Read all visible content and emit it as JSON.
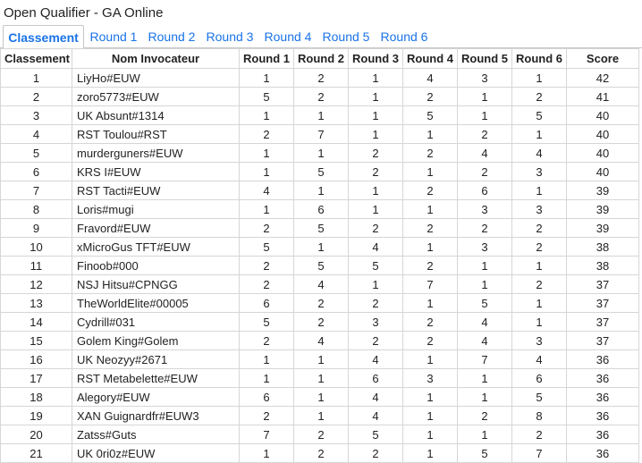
{
  "title": "Open Qualifier - GA Online",
  "tabs": [
    {
      "label": "Classement",
      "active": true
    },
    {
      "label": "Round 1",
      "active": false
    },
    {
      "label": "Round 2",
      "active": false
    },
    {
      "label": "Round 3",
      "active": false
    },
    {
      "label": "Round 4",
      "active": false
    },
    {
      "label": "Round 5",
      "active": false
    },
    {
      "label": "Round 6",
      "active": false
    }
  ],
  "colors": {
    "accent": "#1a73e8",
    "border": "#d6d6d6"
  },
  "table": {
    "headers": [
      "Classement",
      "Nom Invocateur",
      "Round 1",
      "Round 2",
      "Round 3",
      "Round 4",
      "Round 5",
      "Round 6",
      "Score"
    ],
    "rows": [
      [
        "1",
        "LiyHo#EUW",
        "1",
        "2",
        "1",
        "4",
        "3",
        "1",
        "42"
      ],
      [
        "2",
        "zoro5773#EUW",
        "5",
        "2",
        "1",
        "2",
        "1",
        "2",
        "41"
      ],
      [
        "3",
        "UK Absunt#1314",
        "1",
        "1",
        "1",
        "5",
        "1",
        "5",
        "40"
      ],
      [
        "4",
        "RST Toulou#RST",
        "2",
        "7",
        "1",
        "1",
        "2",
        "1",
        "40"
      ],
      [
        "5",
        "murderguners#EUW",
        "1",
        "1",
        "2",
        "2",
        "4",
        "4",
        "40"
      ],
      [
        "6",
        "KRS I#EUW",
        "1",
        "5",
        "2",
        "1",
        "2",
        "3",
        "40"
      ],
      [
        "7",
        "RST Tacti#EUW",
        "4",
        "1",
        "1",
        "2",
        "6",
        "1",
        "39"
      ],
      [
        "8",
        "Loris#mugi",
        "1",
        "6",
        "1",
        "1",
        "3",
        "3",
        "39"
      ],
      [
        "9",
        "Fravord#EUW",
        "2",
        "5",
        "2",
        "2",
        "2",
        "2",
        "39"
      ],
      [
        "10",
        "xMicroGus TFT#EUW",
        "5",
        "1",
        "4",
        "1",
        "3",
        "2",
        "38"
      ],
      [
        "11",
        "Finoob#000",
        "2",
        "5",
        "5",
        "2",
        "1",
        "1",
        "38"
      ],
      [
        "12",
        "NSJ Hitsu#CPNGG",
        "2",
        "4",
        "1",
        "7",
        "1",
        "2",
        "37"
      ],
      [
        "13",
        "TheWorldElite#00005",
        "6",
        "2",
        "2",
        "1",
        "5",
        "1",
        "37"
      ],
      [
        "14",
        "Cydrill#031",
        "5",
        "2",
        "3",
        "2",
        "4",
        "1",
        "37"
      ],
      [
        "15",
        "Golem King#Golem",
        "2",
        "4",
        "2",
        "2",
        "4",
        "3",
        "37"
      ],
      [
        "16",
        "UK Neozyy#2671",
        "1",
        "1",
        "4",
        "1",
        "7",
        "4",
        "36"
      ],
      [
        "17",
        "RST Metabelette#EUW",
        "1",
        "1",
        "6",
        "3",
        "1",
        "6",
        "36"
      ],
      [
        "18",
        "Alegory#EUW",
        "6",
        "1",
        "4",
        "1",
        "1",
        "5",
        "36"
      ],
      [
        "19",
        "XAN Guignardfr#EUW3",
        "2",
        "1",
        "4",
        "1",
        "2",
        "8",
        "36"
      ],
      [
        "20",
        "Zatss#Guts",
        "7",
        "2",
        "5",
        "1",
        "1",
        "2",
        "36"
      ],
      [
        "21",
        "UK 0ri0z#EUW",
        "1",
        "2",
        "2",
        "1",
        "5",
        "7",
        "36"
      ]
    ]
  }
}
